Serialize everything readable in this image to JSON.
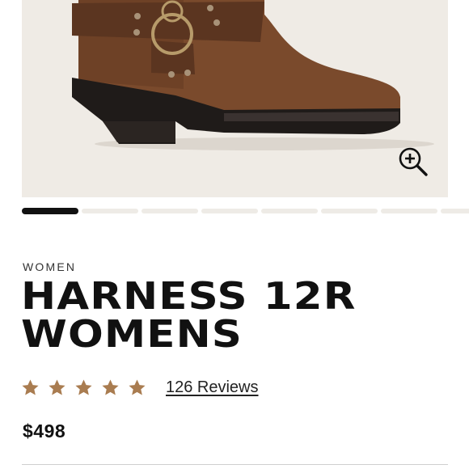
{
  "gallery": {
    "image_alt": "Harness 12R Womens boot",
    "zoom_icon": "zoom-in-icon",
    "slide_count": 8,
    "active_slide": 1
  },
  "product": {
    "category": "WOMEN",
    "title_line1": "HARNESS 12R",
    "title_line2": "WOMENS",
    "rating": 5,
    "reviews_label": "126 Reviews",
    "price": "$498"
  },
  "colors": {
    "star": "#a97c50",
    "gallery_bg": "#efebe5",
    "active_dot": "#111111",
    "inactive_dot": "#eeebe6"
  }
}
